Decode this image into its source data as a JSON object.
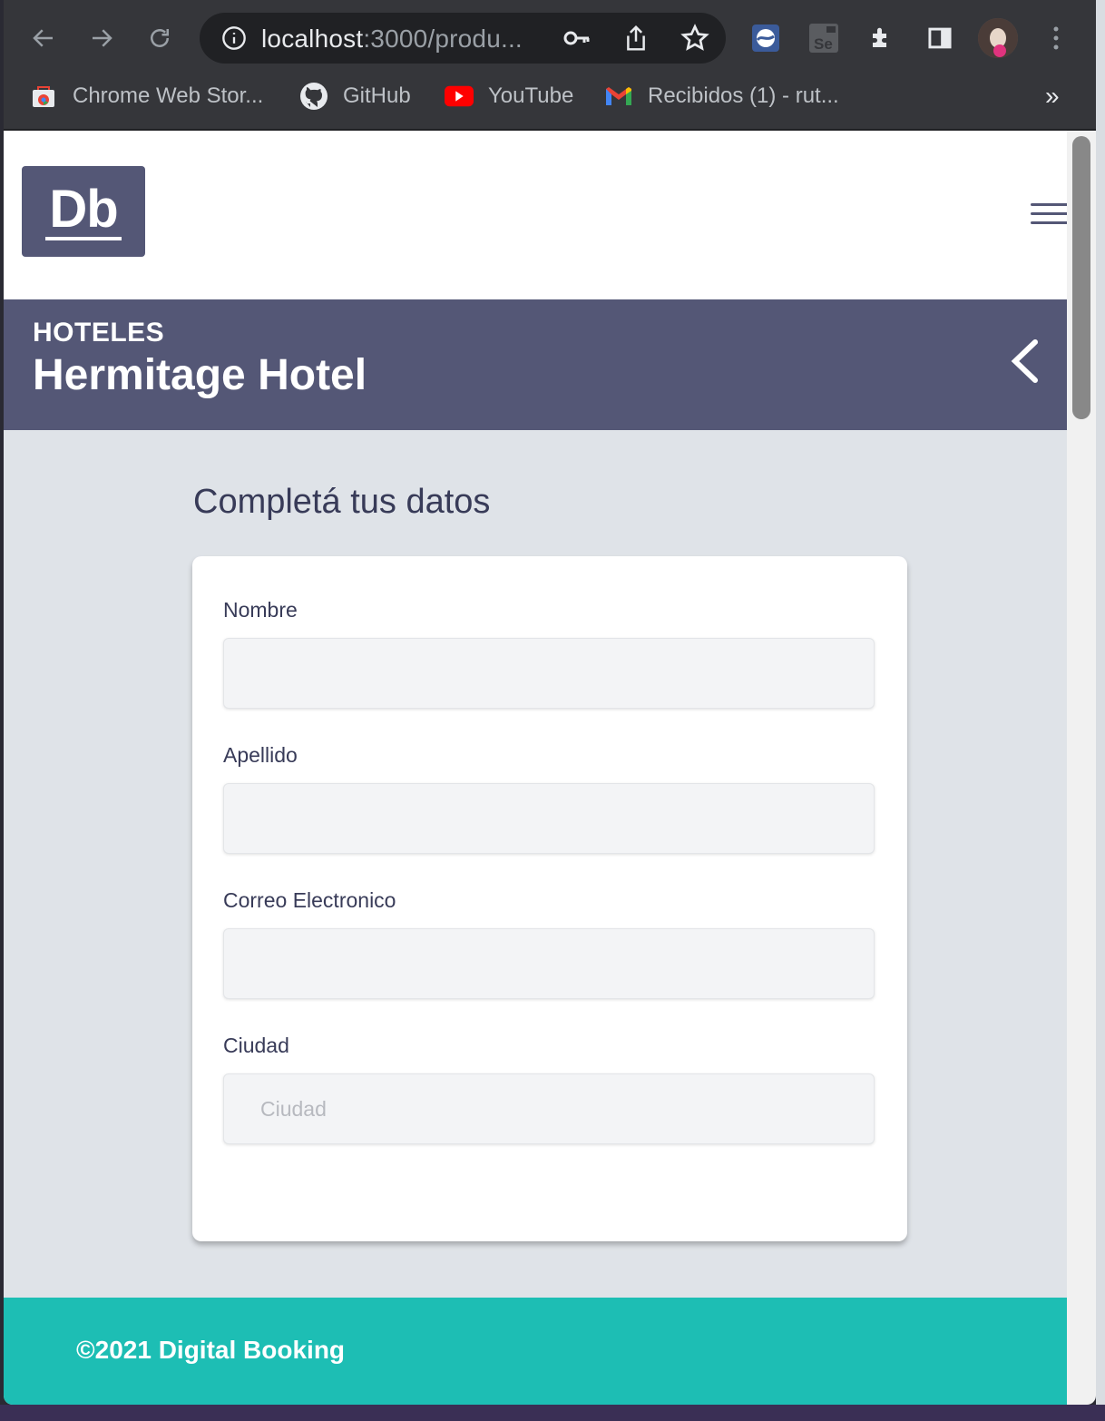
{
  "browser": {
    "url_host": "localhost",
    "url_rest": ":3000/produ...",
    "bookmarks": [
      {
        "label": "Chrome Web Stor...",
        "icon": "chrome-web-store-icon"
      },
      {
        "label": "GitHub",
        "icon": "github-icon"
      },
      {
        "label": "YouTube",
        "icon": "youtube-icon"
      },
      {
        "label": "Recibidos (1) - rut...",
        "icon": "gmail-icon"
      }
    ],
    "more_bookmarks": "»"
  },
  "site": {
    "logo_text": "Db"
  },
  "product": {
    "category": "HOTELES",
    "name": "Hermitage Hotel"
  },
  "form": {
    "title": "Completá tus datos",
    "fields": [
      {
        "label": "Nombre",
        "value": "",
        "placeholder": ""
      },
      {
        "label": "Apellido",
        "value": "",
        "placeholder": ""
      },
      {
        "label": "Correo Electronico",
        "value": "",
        "placeholder": ""
      },
      {
        "label": "Ciudad",
        "value": "",
        "placeholder": "Ciudad"
      }
    ]
  },
  "footer": {
    "copyright": "©2021 Digital Booking"
  },
  "colors": {
    "primary": "#545776",
    "accent": "#1dbeb4",
    "page_bg": "#dfe3e8"
  }
}
